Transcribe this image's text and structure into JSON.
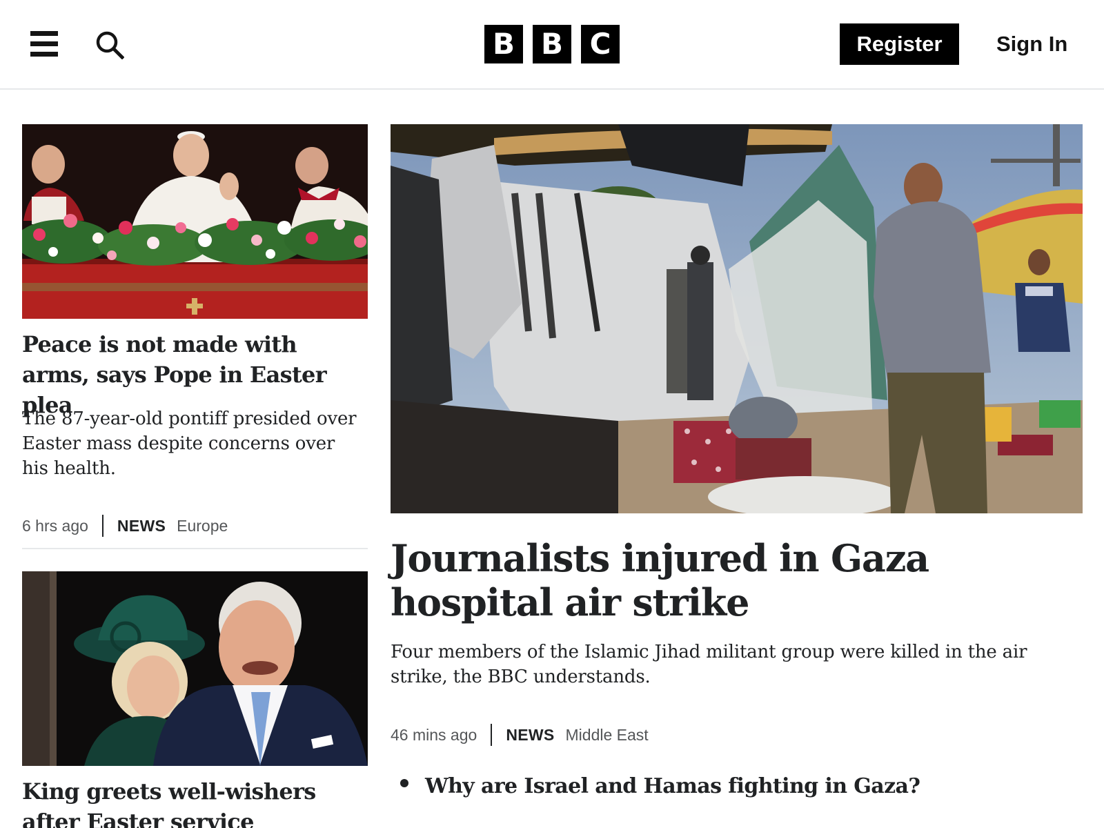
{
  "header": {
    "logo_letters": [
      "B",
      "B",
      "C"
    ],
    "register_label": "Register",
    "signin_label": "Sign In",
    "icons": [
      "menu-icon",
      "search-icon"
    ]
  },
  "stories": [
    {
      "headline": "Peace is not made with arms, says Pope in Easter plea",
      "summary": "The 87-year-old pontiff presided over Easter mass despite concerns over his health.",
      "time": "6 hrs ago",
      "brand": "NEWS",
      "section": "Europe"
    },
    {
      "headline": "King greets well-wishers after Easter service"
    }
  ],
  "lead": {
    "headline": "Journalists injured in Gaza hospital air strike",
    "summary": "Four members of the Islamic Jihad militant group were killed in the air strike, the BBC understands.",
    "time": "46 mins ago",
    "brand": "NEWS",
    "section": "Middle East",
    "related": [
      "Why are Israel and Hamas fighting in Gaza?"
    ]
  },
  "colors": {
    "text": "#202224",
    "muted": "#545658",
    "divider": "#e6e8ea",
    "brand_black": "#000000"
  }
}
